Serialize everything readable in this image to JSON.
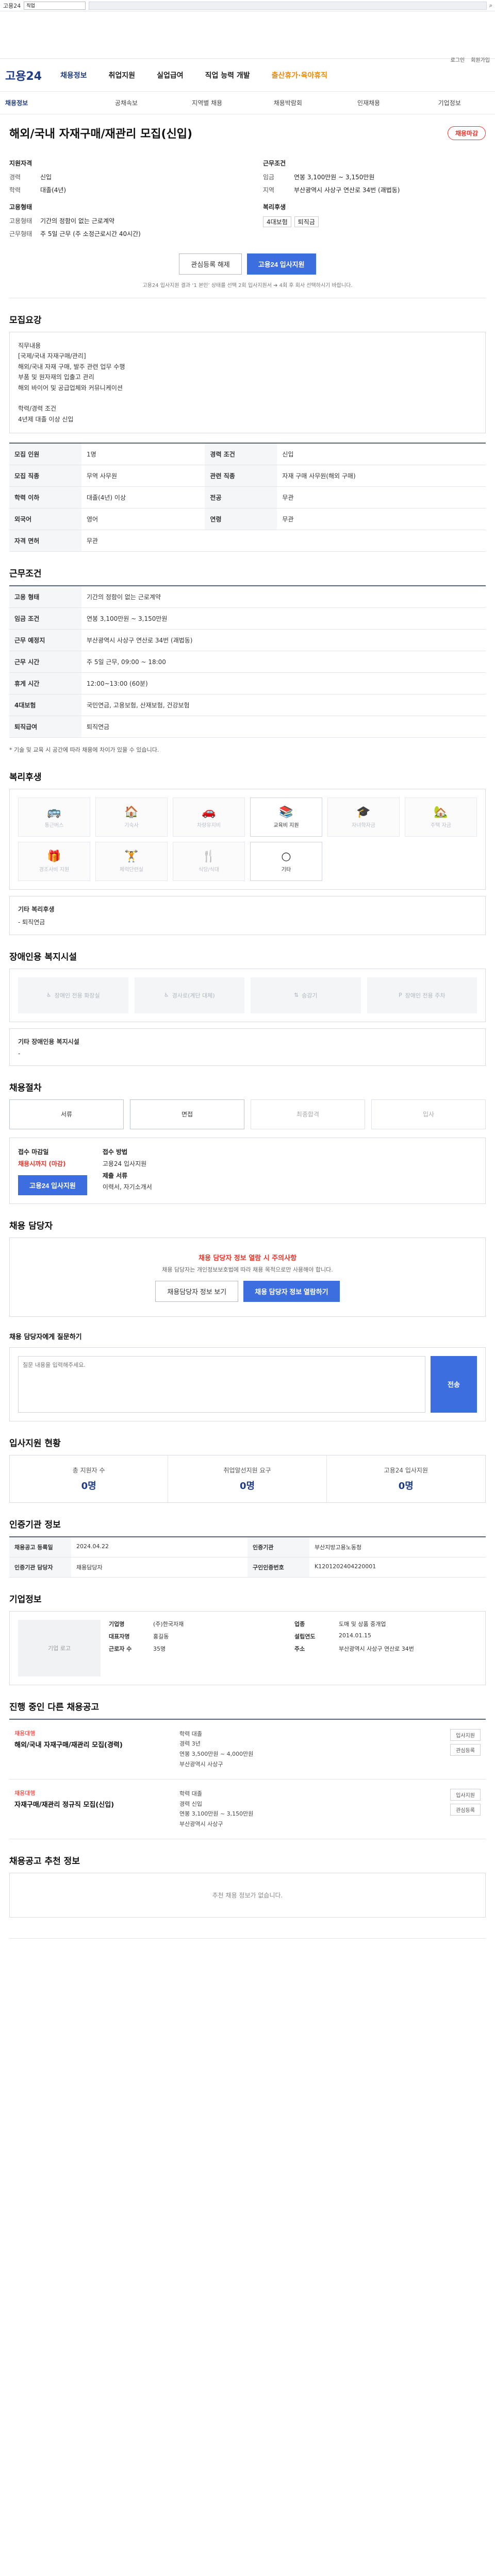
{
  "topbar": {
    "site": "고용24",
    "search_value": "직업",
    "search_placeholder": "검색어 입력",
    "search_icon": "search-icon"
  },
  "util": {
    "links": [
      "로그인",
      "회원가입"
    ]
  },
  "gnb": {
    "logo": "고용24",
    "menus": [
      "채용정보",
      "취업지원",
      "실업급여",
      "직업 능력 개발",
      "출산휴가·육아휴직"
    ]
  },
  "sub": {
    "items": [
      "채용정보",
      "공채속보",
      "지역별 채용",
      "채용박람회",
      "인재채용",
      "기업정보"
    ]
  },
  "job": {
    "title": "해외/국내 자재구매/재관리 모집(신입)",
    "badge": "채용마감",
    "left_header": "지원자격",
    "left": [
      {
        "k": "경력",
        "v": "신입"
      },
      {
        "k": "학력",
        "v": "대졸(4년)"
      }
    ],
    "left2_header": "고용형태",
    "left2": [
      {
        "k": "고용형태",
        "v": "기간의 정함이 없는 근로계약"
      },
      {
        "k": "근무형태",
        "v": "주 5일 근무 (주 소정근로시간 40시간)"
      }
    ],
    "right_header": "근무조건",
    "right": [
      {
        "k": "임금",
        "v": "연봉 3,100만원 ~ 3,150만원"
      },
      {
        "k": "지역",
        "v": "부산광역시 사상구 연산로 34번 (괘법동)"
      }
    ],
    "right2_header": "복리후생",
    "right2_tags": [
      "4대보험",
      "퇴직금"
    ],
    "btn_interest": "관심등록 해제",
    "btn_apply": "고용24 입사지원",
    "note": "고용24 입사지원 결과 ‘1 본인’ 상태를 선택 2회 입사지원서 ➔ 4회 후 회사 선택하시기 바랍니다."
  },
  "sec_duty": {
    "title": "모집요강",
    "text": "직무내용\n[국제/국내 자재구매/관리]\n해외/국내 자재 구매, 발주 관련 업무 수행\n부품 및 원자재의 입출고 관리\n해외 바이어 및 공급업체와 커뮤니케이션\n\n학력/경력 조건\n4년제 대졸 이상 신입"
  },
  "recruit_table": [
    {
      "k": "모집 인원",
      "v": "1명",
      "k2": "경력 조건",
      "v2": "신입"
    },
    {
      "k": "모집 직종",
      "v": "무역 사무원",
      "k2": "관련 직종",
      "v2": "자재 구매 사무원(해외 구매)"
    },
    {
      "k": "학력 이하",
      "v": "대졸(4년) 이상",
      "k2": "전공",
      "v2": "무관"
    },
    {
      "k": "외국어",
      "v": "영어",
      "k2": "연령",
      "v2": "무관"
    },
    {
      "k": "자격 면허",
      "v": "무관",
      "k2": "",
      "v2": ""
    }
  ],
  "sec_cond": {
    "title": "근무조건"
  },
  "cond_table": [
    {
      "k": "고용 형태",
      "v": "기간의 정함이 없는 근로계약"
    },
    {
      "k": "임금 조건",
      "v": "연봉 3,100만원 ~ 3,150만원"
    },
    {
      "k": "근무 예정지",
      "v": "부산광역시 사상구 연산로 34번 (괘법동)"
    },
    {
      "k": "근무 시간",
      "v": "주 5일 근무, 09:00 ~ 18:00"
    },
    {
      "k": "휴게 시간",
      "v": "12:00~13:00 (60분)"
    },
    {
      "k": "4대보험",
      "v": "국민연금, 고용보험, 산재보험, 건강보험"
    },
    {
      "k": "퇴직급여",
      "v": "퇴직연금"
    }
  ],
  "cond_note": "* 기술 및 교육 시 공간에 따라 채용에 차이가 있을 수 있습니다.",
  "sec_welfare": {
    "title": "복리후생",
    "items": [
      "통근버스",
      "기숙사",
      "차량유지비",
      "교육비 지원",
      "자녀학자금",
      "주택 자금",
      "경조사비 지원",
      "체력단련실",
      "식당/식대",
      "기타"
    ],
    "active": [
      3,
      9
    ],
    "extra_title": "기타 복리후생",
    "extra": "- 퇴직연금"
  },
  "sec_fac": {
    "title": "장애인용 복지시설",
    "items": [
      "장애인 전용 화장실",
      "경사로(계단 대체)",
      "승강기",
      "장애인 전용 주차"
    ],
    "extra_title": "기타 장애인용 복지시설",
    "extra": "-"
  },
  "sec_steps": {
    "title": "채용절차",
    "steps": [
      "서류",
      "면접",
      "최종합격",
      "입사"
    ],
    "active": [
      0,
      1
    ]
  },
  "sec_apply": {
    "title": "접수 마감일",
    "deadline": "채용시까지 (마감)",
    "method_title": "접수 방법",
    "method": "고용24 입사지원",
    "docs_title": "제출 서류",
    "docs": "이력서, 자기소개서",
    "btn": "고용24 입사지원"
  },
  "sec_contact": {
    "title": "채용 담당자",
    "notice": "채용 담당자 정보 열람 시 주의사항",
    "p1": "채용 담당자는 개인정보보호법에 따라 채용 목적으로만 사용해야 합니다.",
    "btn_view": "채용담당자 정보 보기",
    "btn_apply": "채용 담당자 정보 열람하기"
  },
  "sec_qna": {
    "title": "채용 담당자에게 질문하기",
    "placeholder": "질문 내용을 입력해주세요.",
    "send": "전송"
  },
  "sec_stats": {
    "title": "입사지원 현황",
    "items": [
      {
        "l": "총 지원자 수",
        "n": "0명"
      },
      {
        "l": "취업알선지원 요구",
        "n": "0명"
      },
      {
        "l": "고용24 입사지원",
        "n": "0명"
      }
    ]
  },
  "sec_manage": {
    "title": "인증기관 정보",
    "rows": [
      {
        "k": "채용공고 등록일",
        "v": "2024.04.22",
        "k2": "인증기관",
        "v2": "부산지방고용노동청"
      },
      {
        "k": "인증기관 담당자",
        "v": "채용담당자",
        "k2": "구인인증번호",
        "v2": "K1201202404220001"
      }
    ]
  },
  "sec_company": {
    "title": "기업정보",
    "logo": "기업 로고",
    "fields": [
      {
        "k": "기업명",
        "v": "(주)한국자재"
      },
      {
        "k": "업종",
        "v": "도매 및 상품 중개업"
      },
      {
        "k": "대표자명",
        "v": "홍길동"
      },
      {
        "k": "설립연도",
        "v": "2014.01.15"
      },
      {
        "k": "근로자 수",
        "v": "35명"
      },
      {
        "k": "주소",
        "v": "부산광역시 사상구 연산로 34번"
      }
    ]
  },
  "sec_similar": {
    "title": "진행 중인 다른 채용공고",
    "items": [
      {
        "co": "채용대행",
        "title": "해외/국내 자재구매/재관리 모집(경력)",
        "meta": [
          "학력 대졸",
          "경력 3년",
          "연봉 3,500만원 ~ 4,000만원",
          "부산광역시 사상구"
        ],
        "btns": [
          "입사지원",
          "관심등록"
        ]
      },
      {
        "co": "채용대행",
        "title": "자재구매/재관리 정규직 모집(신입)",
        "meta": [
          "학력 대졸",
          "경력 신입",
          "연봉 3,100만원 ~ 3,150만원",
          "부산광역시 사상구"
        ],
        "btns": [
          "입사지원",
          "관심등록"
        ]
      }
    ]
  },
  "sec_empty": {
    "title": "채용공고 추천 정보",
    "text": "추천 채용 정보가 없습니다."
  },
  "colors": {
    "brand": "#1f3d87",
    "accent": "#3d6ee0",
    "alert": "#e3382c"
  }
}
